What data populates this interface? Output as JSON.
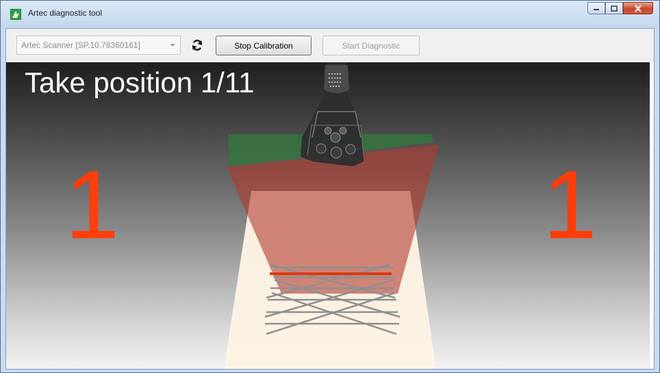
{
  "window": {
    "title": "Artec diagnostic tool",
    "icon": "artec-app-icon"
  },
  "toolbar": {
    "scanner_select": {
      "value": "Artec Scanner [SP.10.78360161]"
    },
    "refresh_icon": "refresh-icon",
    "stop_calibration_label": "Stop Calibration",
    "start_diagnostic_label": "Start Diagnostic"
  },
  "viewport": {
    "instruction": "Take position 1/11",
    "position_left": "1",
    "position_right": "1"
  },
  "colors": {
    "position_digit": "#ff3e0a",
    "target_line": "#d83a12",
    "green_plane": "#2f7a3a",
    "red_plane": "#b23a2e",
    "light_beam": "#fdf3e4"
  }
}
